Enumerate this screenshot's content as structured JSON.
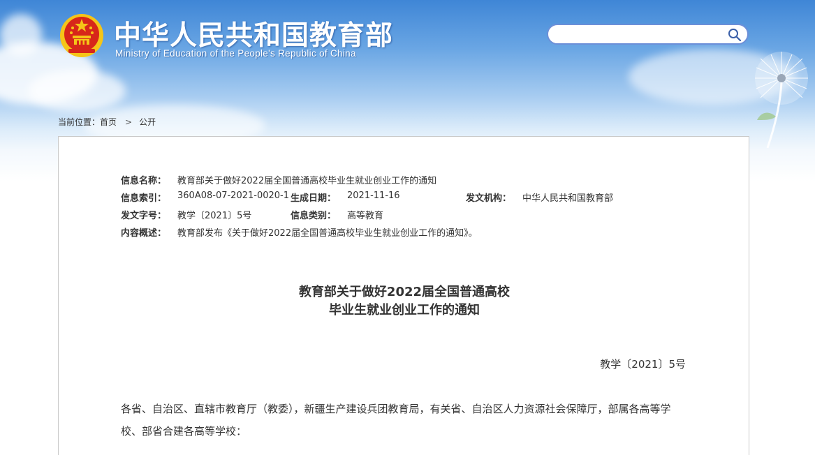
{
  "header": {
    "title_cn": "中华人民共和国教育部",
    "title_en": "Ministry of Education of the People's Republic of China",
    "emblem_icon": "national-emblem-icon",
    "search": {
      "value": "",
      "placeholder": "",
      "icon": "search-icon"
    }
  },
  "breadcrumb": {
    "prefix": "当前位置：",
    "items": [
      "首页",
      "公开"
    ],
    "separator": ">"
  },
  "info": {
    "name_label": "信息名称：",
    "name_value": "教育部关于做好2022届全国普通高校毕业生就业创业工作的通知",
    "index_label": "信息索引：",
    "index_value": "360A08-07-2021-0020-1",
    "date_label": "生成日期：",
    "date_value": "2021-11-16",
    "org_label": "发文机构：",
    "org_value": "中华人民共和国教育部",
    "docno_label": "发文字号：",
    "docno_value": "教学〔2021〕5号",
    "category_label": "信息类别：",
    "category_value": "高等教育",
    "summary_label": "内容概述：",
    "summary_value": "教育部发布《关于做好2022届全国普通高校毕业生就业创业工作的通知》。"
  },
  "document": {
    "title_line1": "教育部关于做好2022届全国普通高校",
    "title_line2": "毕业生就业创业工作的通知",
    "number": "教学〔2021〕5号",
    "body_p1": "各省、自治区、直辖市教育厅（教委），新疆生产建设兵团教育局，有关省、自治区人力资源社会保障厅，部属各高等学校、部省合建各高等学校："
  },
  "colors": {
    "sky_top": "#3f86d6",
    "search_border": "#6c8fd8",
    "text": "#333333",
    "emblem_red": "#d7261a",
    "emblem_gold": "#f5c518"
  }
}
